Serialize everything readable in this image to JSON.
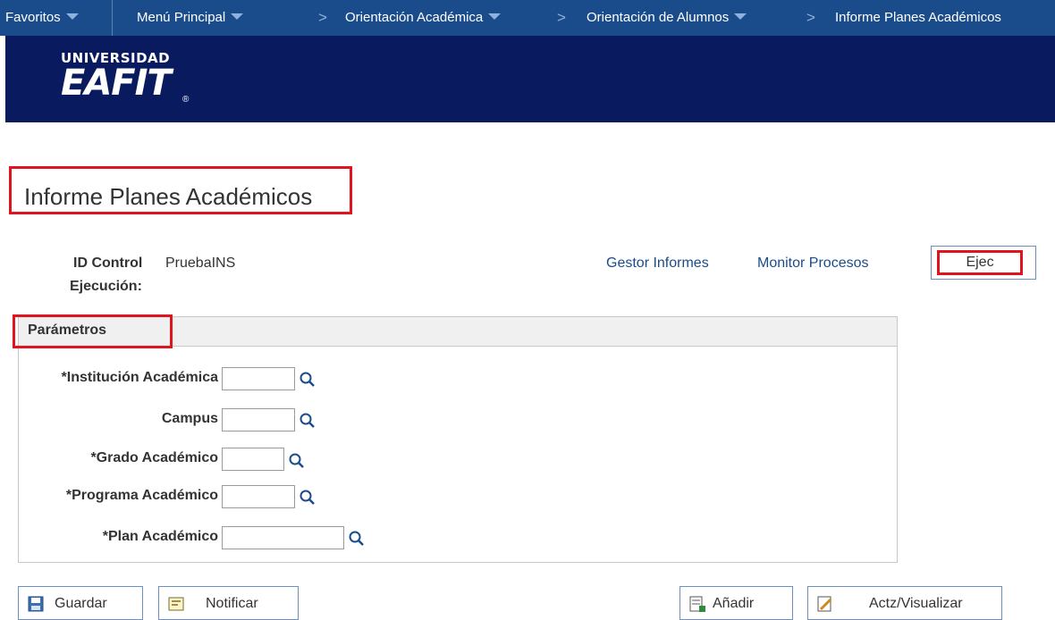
{
  "nav": {
    "favorites": "Favoritos",
    "main_menu": "Menú Principal",
    "crumb1": "Orientación Académica",
    "crumb2": "Orientación de Alumnos",
    "crumb3": "Informe Planes Académicos",
    "separator": ">"
  },
  "banner": {
    "logo_top": "UNIVERSIDAD",
    "logo_main": "EAFIT",
    "logo_reg": "®"
  },
  "page": {
    "title": "Informe Planes Académicos"
  },
  "run_control": {
    "label_line1": "ID Control",
    "label_line2": "Ejecución:",
    "value": "PruebaINS",
    "report_manager": "Gestor Informes",
    "process_monitor": "Monitor Procesos",
    "run_button": "Ejec"
  },
  "params": {
    "header": "Parámetros",
    "fields": [
      {
        "label": "*Institución Académica",
        "value": ""
      },
      {
        "label": "Campus",
        "value": ""
      },
      {
        "label": "*Grado Académico",
        "value": ""
      },
      {
        "label": "*Programa Académico",
        "value": ""
      },
      {
        "label": "*Plan Académico",
        "value": ""
      }
    ]
  },
  "buttons": {
    "save": "Guardar",
    "notify": "Notificar",
    "add": "Añadir",
    "update": "Actz/Visualizar"
  },
  "colors": {
    "nav_bg": "#1a4c8c",
    "banner_bg": "#0a1a5e",
    "highlight": "#e0141e",
    "link": "#1a4c8c"
  },
  "icons": [
    "chevron-down-icon",
    "lookup-icon",
    "save-icon",
    "notify-icon",
    "add-icon",
    "update-icon"
  ]
}
